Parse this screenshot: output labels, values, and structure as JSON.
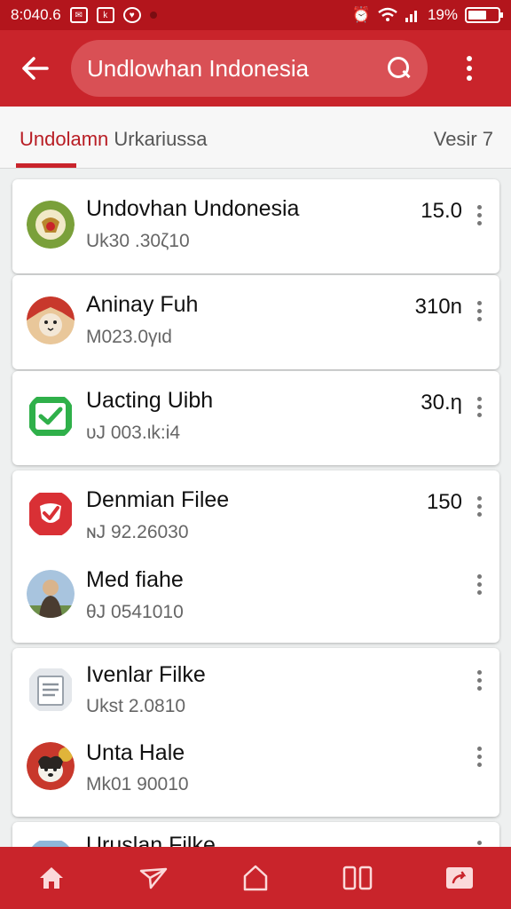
{
  "status_bar": {
    "time": "8:040.6",
    "battery_percent": "19%"
  },
  "app_bar": {
    "search_text": "Undlowhan Indonesia"
  },
  "tabs": {
    "active_primary": "Undolamn",
    "active_secondary": "Urkariussa",
    "version": "Vesir 7"
  },
  "items": [
    {
      "title": "Undovhan Undonesia",
      "subtitle": "Uk30 .30ζ10",
      "value": "15.0",
      "icon": "emblem-icon",
      "color": "#7aa03a"
    },
    {
      "title": "Aninay Fuh",
      "subtitle": "M023.0γιd",
      "value": "310n",
      "icon": "cat-portrait-icon",
      "color": "#c8382c"
    },
    {
      "title": "Uacting Uibh",
      "subtitle": "υJ 003.ιk:i4",
      "value": "30.η",
      "icon": "check-square-icon",
      "color": "#2fb04a"
    },
    {
      "title": "Denmian Filee",
      "subtitle": "ɴJ 92.26030",
      "value": "150",
      "icon": "shield-check-icon",
      "color": "#d93035"
    },
    {
      "title": "Med fiahe",
      "subtitle": "θJ 0541010",
      "value": "",
      "icon": "person-photo-icon",
      "color": "#7fa7c9"
    },
    {
      "title": "Ivenlar Filke",
      "subtitle": "Ukst 2.0810",
      "value": "",
      "icon": "document-icon",
      "color": "#d9dde3"
    },
    {
      "title": "Unta Hale",
      "subtitle": "Mk01 90010",
      "value": "",
      "icon": "dog-photo-icon",
      "color": "#c8382c"
    },
    {
      "title": "Uruslan Filke",
      "subtitle": "",
      "value": "",
      "icon": "photo-icon",
      "color": "#8fb7da"
    }
  ],
  "bottom_nav": [
    "home-icon",
    "send-icon",
    "house-outline-icon",
    "columns-icon",
    "cast-icon"
  ],
  "colors": {
    "brand": "#c9242b",
    "status_bar": "#b3151c"
  }
}
